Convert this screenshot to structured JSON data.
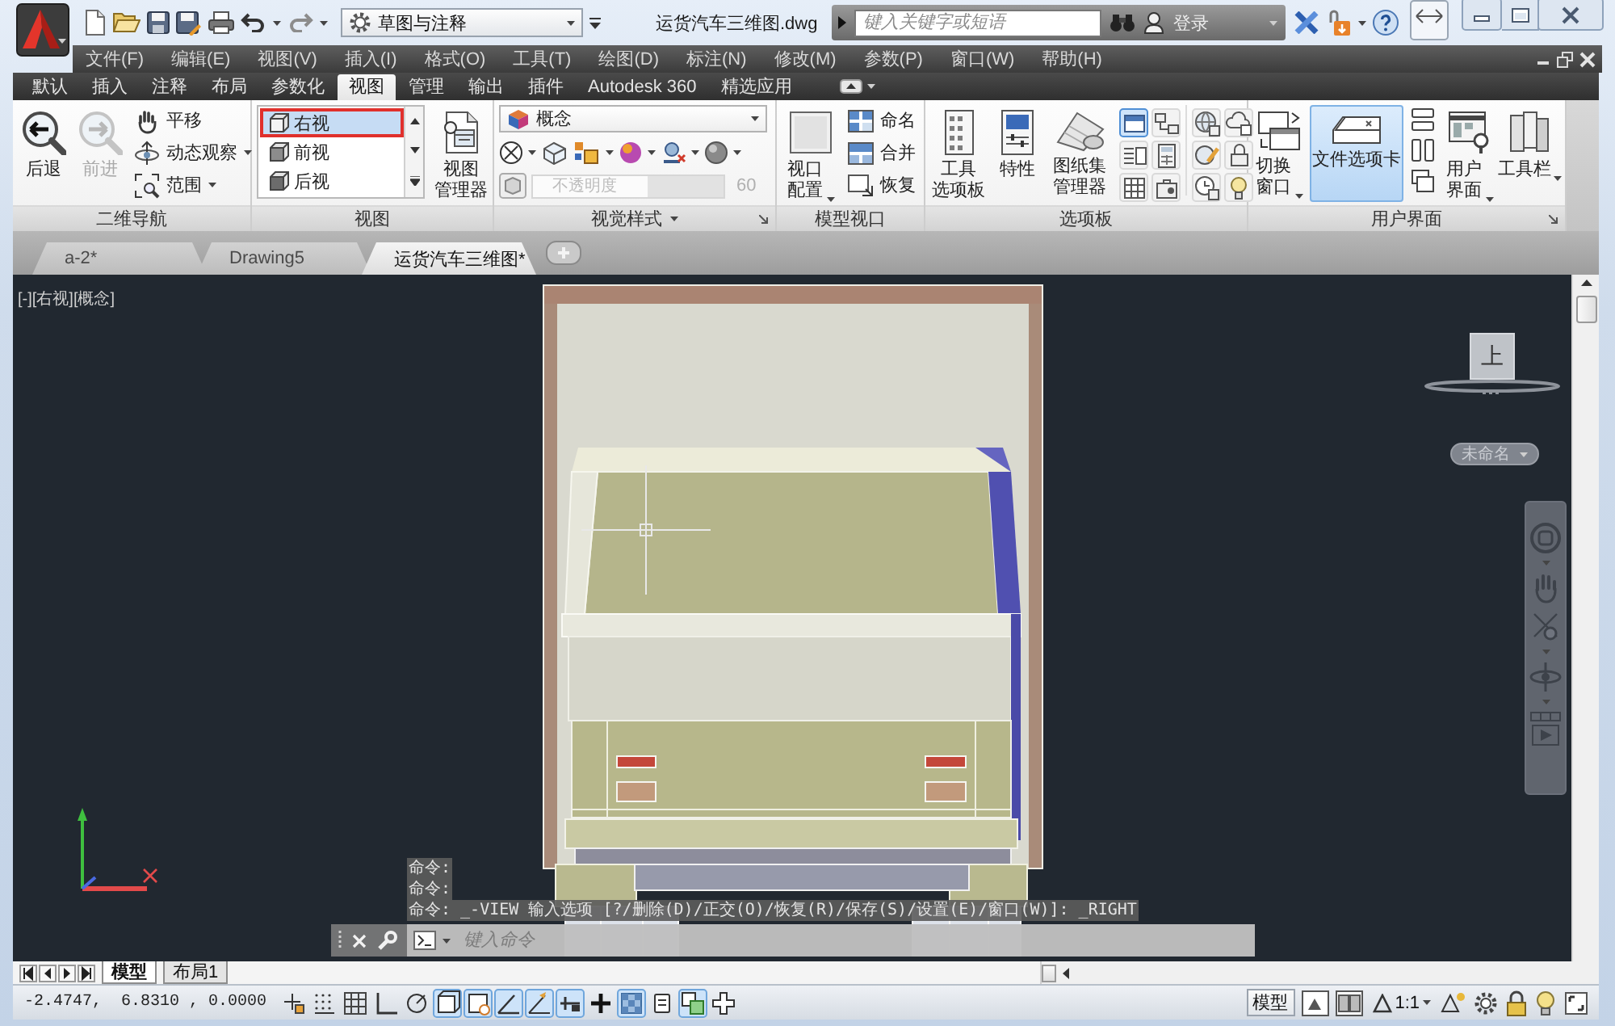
{
  "title_bar": {
    "workspace": "草图与注释",
    "document_title": "运货汽车三维图.dwg",
    "search": {
      "placeholder": "键入关键字或短语"
    },
    "sign_in": "登录"
  },
  "menu_bar": [
    "文件(F)",
    "编辑(E)",
    "视图(V)",
    "插入(I)",
    "格式(O)",
    "工具(T)",
    "绘图(D)",
    "标注(N)",
    "修改(M)",
    "参数(P)",
    "窗口(W)",
    "帮助(H)"
  ],
  "ribbon_tabs": [
    {
      "label": "默认",
      "selected": false
    },
    {
      "label": "插入",
      "selected": false
    },
    {
      "label": "注释",
      "selected": false
    },
    {
      "label": "布局",
      "selected": false
    },
    {
      "label": "参数化",
      "selected": false
    },
    {
      "label": "视图",
      "selected": true
    },
    {
      "label": "管理",
      "selected": false
    },
    {
      "label": "输出",
      "selected": false
    },
    {
      "label": "插件",
      "selected": false
    },
    {
      "label": "Autodesk 360",
      "selected": false
    },
    {
      "label": "精选应用",
      "selected": false
    }
  ],
  "ribbon_panels": [
    {
      "kind": "navigation",
      "title": "二维导航",
      "buttons": [
        {
          "label": "后退",
          "disabled": false
        },
        {
          "label": "前进",
          "disabled": true
        }
      ],
      "tools": [
        {
          "label": "平移",
          "dropdown": false
        },
        {
          "label": "动态观察",
          "dropdown": true
        },
        {
          "label": "范围",
          "dropdown": true
        }
      ]
    },
    {
      "kind": "views",
      "title": "视图",
      "views": [
        {
          "label": "右视",
          "selected": true
        },
        {
          "label": "前视",
          "selected": false
        },
        {
          "label": "后视",
          "selected": false
        }
      ],
      "manager": "视图管理器"
    },
    {
      "kind": "visual_styles",
      "title": "视觉样式",
      "style": "概念",
      "opacity": {
        "label": "不透明度",
        "value": "60",
        "level": 0.6,
        "disabled": true
      }
    },
    {
      "kind": "viewports",
      "title": "模型视口",
      "config": "视口配置",
      "tools": [
        "命名",
        "合并",
        "恢复"
      ]
    },
    {
      "kind": "palettes",
      "title": "选项板",
      "buttons": [
        "工具选项板",
        "特性",
        "图纸集管理器"
      ],
      "toggles": [
        {
          "on": true
        },
        {
          "on": false
        },
        {
          "on": false
        },
        {
          "on": false
        },
        {
          "on": false
        },
        {
          "on": false
        }
      ]
    },
    {
      "kind": "user_interface",
      "title": "用户界面",
      "buttons": [
        {
          "label": "切换窗口",
          "on": false,
          "dropdown": true
        },
        {
          "label": "文件选项卡",
          "on": true,
          "dropdown": false
        },
        {
          "label": "用户界面",
          "on": false,
          "dropdown": true
        },
        {
          "label": "工具栏",
          "on": false,
          "dropdown": true
        }
      ]
    }
  ],
  "document_tabs": [
    {
      "label": "a-2*",
      "selected": false
    },
    {
      "label": "Drawing5",
      "selected": false
    },
    {
      "label": "运货汽车三维图*",
      "selected": true
    }
  ],
  "viewport": {
    "label": "[-][右视][概念]",
    "viewcube_face": "上",
    "coordinate_system": "未命名",
    "command_history": [
      "命令:",
      "命令:",
      "命令: _-VIEW 输入选项 [?/删除(D)/正交(O)/恢复(R)/保存(S)/设置(E)/窗口(W)]: _RIGHT"
    ],
    "command_input": {
      "placeholder": "键入命令"
    }
  },
  "layout_tabs": [
    {
      "label": "模型",
      "selected": true
    },
    {
      "label": "布局1",
      "selected": false
    }
  ],
  "status_bar": {
    "coordinates": "-2.4747,  6.8310 , 0.0000",
    "toggles": [
      {
        "on": false
      },
      {
        "on": false
      },
      {
        "on": false
      },
      {
        "on": false
      },
      {
        "on": false
      },
      {
        "on": true
      },
      {
        "on": true
      },
      {
        "on": true
      },
      {
        "on": true
      },
      {
        "on": true
      },
      {
        "on": false
      },
      {
        "on": true
      },
      {
        "on": false
      },
      {
        "on": true
      },
      {
        "on": false
      }
    ],
    "space": "模型",
    "annotation_scale": "1:1"
  }
}
